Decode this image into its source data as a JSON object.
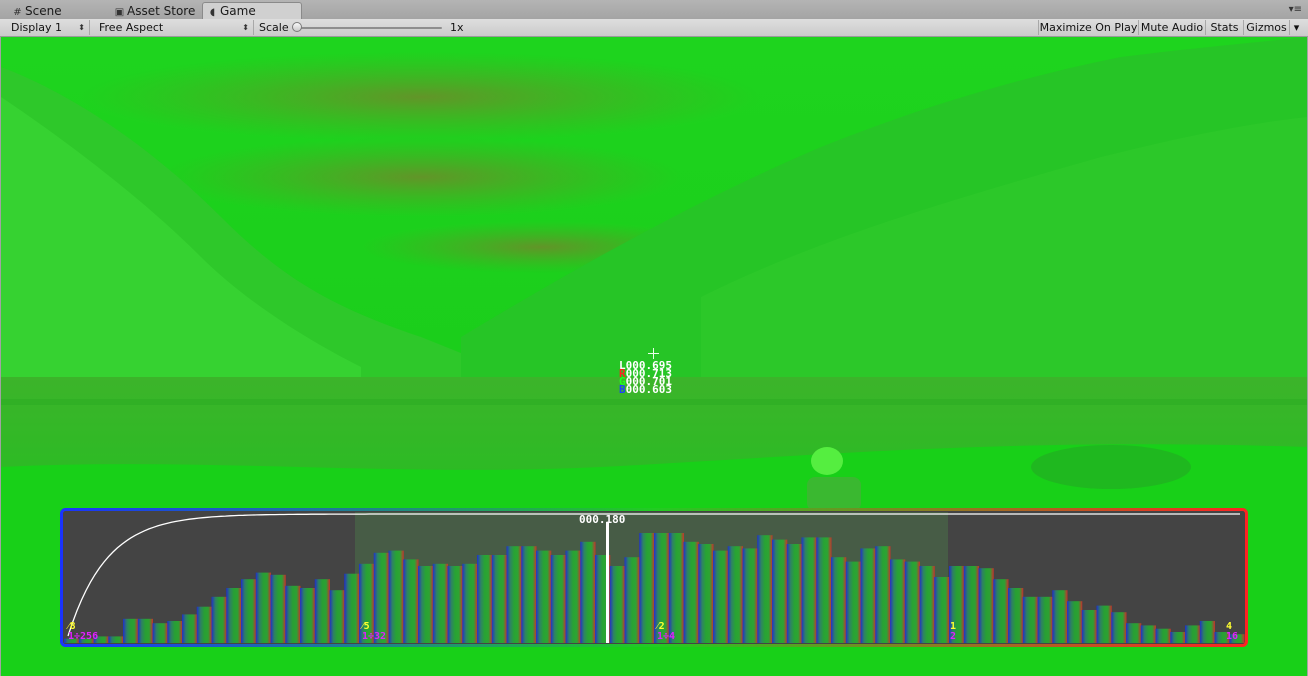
{
  "tabs": [
    {
      "label": "Scene",
      "icon": "grid-icon"
    },
    {
      "label": "Asset Store",
      "icon": "store-icon"
    },
    {
      "label": "Game",
      "icon": "pacman-icon",
      "active": true
    }
  ],
  "toolbar": {
    "display": "Display 1",
    "aspect": "Free Aspect",
    "scale_label": "Scale",
    "scale_value": "1x",
    "maximize": "Maximize On Play",
    "mute": "Mute Audio",
    "stats": "Stats",
    "gizmos": "Gizmos"
  },
  "pixel_readout": {
    "L": "000.695",
    "R": "000.713",
    "G": "000.701",
    "B": "000.603",
    "L_key": "L",
    "R_key": "R",
    "G_key": "G",
    "B_key": "B"
  },
  "histogram": {
    "current_value": "000.180",
    "stop_labels": [
      {
        "top": "⁄8",
        "bottom": "1÷256"
      },
      {
        "top": "⁄5",
        "bottom": "1÷32"
      },
      {
        "top": "⁄2",
        "bottom": "1÷4"
      },
      {
        "top": "1",
        "bottom": "2"
      },
      {
        "top": "4",
        "bottom": "16"
      }
    ],
    "bins": [
      0.04,
      0.04,
      0.06,
      0.06,
      0.22,
      0.22,
      0.18,
      0.2,
      0.26,
      0.33,
      0.42,
      0.5,
      0.58,
      0.64,
      0.62,
      0.52,
      0.5,
      0.58,
      0.48,
      0.63,
      0.72,
      0.82,
      0.84,
      0.76,
      0.7,
      0.72,
      0.7,
      0.72,
      0.8,
      0.8,
      0.88,
      0.88,
      0.84,
      0.8,
      0.84,
      0.92,
      0.8,
      0.7,
      0.78,
      1.0,
      1.0,
      1.0,
      0.92,
      0.9,
      0.84,
      0.88,
      0.86,
      0.98,
      0.94,
      0.9,
      0.96,
      0.96,
      0.78,
      0.74,
      0.86,
      0.88,
      0.76,
      0.74,
      0.7,
      0.6,
      0.7,
      0.7,
      0.68,
      0.58,
      0.5,
      0.42,
      0.42,
      0.48,
      0.38,
      0.3,
      0.34,
      0.28,
      0.18,
      0.16,
      0.13,
      0.1,
      0.16,
      0.2,
      0.1,
      0.08
    ],
    "colors": {
      "low": "#1a33ff",
      "mid": "#22cc22",
      "high": "#ff2222"
    }
  },
  "colors": {
    "game_bg": "#19cf19",
    "terrain_dark": "#4aa82a"
  }
}
